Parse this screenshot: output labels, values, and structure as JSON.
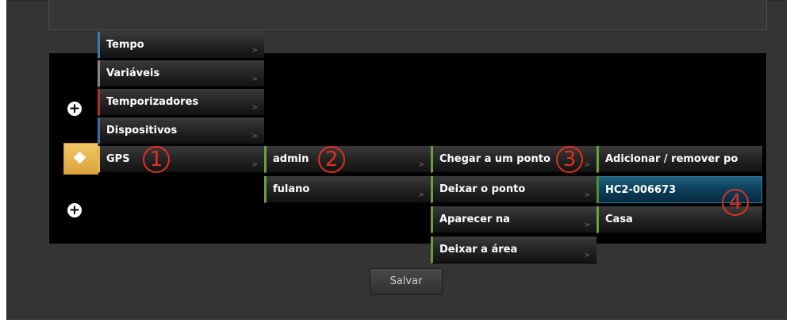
{
  "colors": {
    "panel_bg": "#343434",
    "canvas_bg": "#000000",
    "callout": "#e0301f",
    "highlight": "#0d3f5a",
    "gps_tile": "#e8b552"
  },
  "menu": {
    "level1": [
      {
        "label": "Tempo",
        "arrow": ">",
        "accent": "#3a7ea0"
      },
      {
        "label": "Variáveis",
        "arrow": ">",
        "accent": "#888888"
      },
      {
        "label": "Temporizadores",
        "arrow": ">",
        "accent": "#b0302a"
      },
      {
        "label": "Dispositivos",
        "arrow": ">",
        "accent": "#3a6fa0"
      },
      {
        "label": "GPS",
        "arrow": ">",
        "accent": "#e8b552"
      }
    ],
    "level2": [
      {
        "label": "admin",
        "arrow": ">"
      },
      {
        "label": "fulano",
        "arrow": ">"
      }
    ],
    "level3": [
      {
        "label": "Chegar a um ponto",
        "arrow": ">"
      },
      {
        "label": "Deixar o ponto",
        "arrow": ">"
      },
      {
        "label": "Aparecer na",
        "arrow": ">"
      },
      {
        "label": "Deixar a área",
        "arrow": ">"
      }
    ],
    "level4": [
      {
        "label": "Adicionar / remover po"
      },
      {
        "label": "HC2-006673"
      },
      {
        "label": "Casa"
      }
    ]
  },
  "icons": {
    "plus_top": "+",
    "plus_bottom": "+"
  },
  "callouts": [
    "1",
    "2",
    "3",
    "4"
  ],
  "save_label": "Salvar"
}
